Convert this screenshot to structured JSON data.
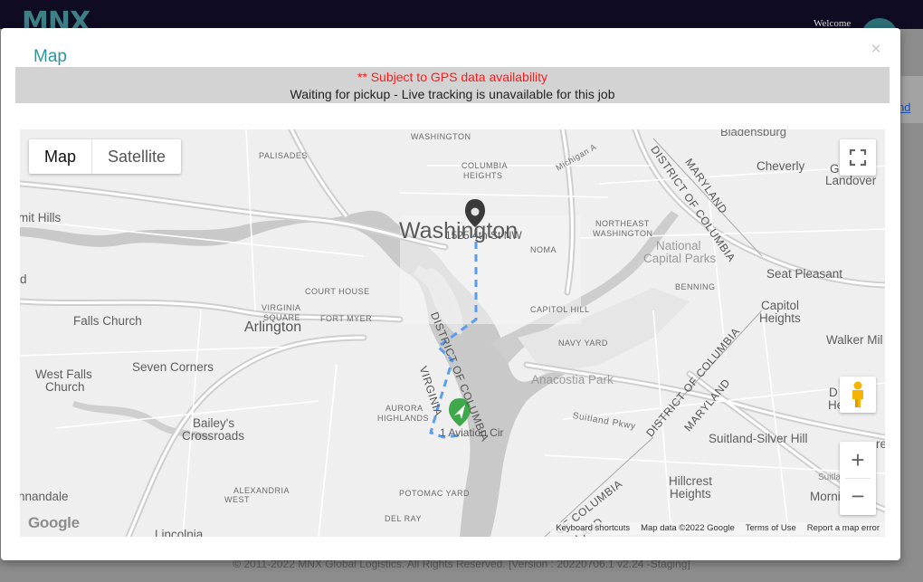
{
  "background": {
    "logo": "MNX",
    "welcome": "Welcome",
    "side_link": "nd",
    "footer": "© 2011-2022 MNX Global Logistics. All Rights Reserved. [Version : 20220706.1 v2.24 -Staging]"
  },
  "modal": {
    "title": "Map",
    "close": "×",
    "warning": "** Subject to GPS data availability",
    "status": "Waiting for pickup - Live tracking is unavailable for this job"
  },
  "map": {
    "type_controls": {
      "map": "Map",
      "satellite": "Satellite"
    },
    "zoom_in": "+",
    "zoom_out": "−",
    "attribution": {
      "shortcuts": "Keyboard shortcuts",
      "data": "Map data ©2022 Google",
      "terms": "Terms of Use",
      "report": "Report a map error"
    },
    "logo": "Google",
    "markers": {
      "destination_address": "1525 4th St NW",
      "origin_address": "1 Aviation Cir"
    },
    "labels": {
      "washington": "Washington",
      "arlington": "Arlington",
      "falls_church": "Falls Church",
      "seven_corners": "Seven Corners",
      "west_falls_church_1": "West Falls",
      "west_falls_church_2": "Church",
      "baileys_1": "Bailey's",
      "baileys_2": "Crossroads",
      "annandale": "nnandale",
      "lincolnia": "Lincolnia",
      "mit_hills": "mit Hills",
      "cheverly": "Cheverly",
      "landover_1": "Gl",
      "landover_2": "Landover",
      "seat_pleasant": "Seat Pleasant",
      "capitol_heights_1": "Capitol",
      "capitol_heights_2": "Heights",
      "walker_mill": "Walker Mil",
      "d_heights_1": "D",
      "d_heights_2": "Heights",
      "suitland": "Suitland-Silver Hill",
      "hillcrest_1": "Hillcrest",
      "hillcrest_2": "Heights",
      "morningside": "Morni",
      "dc_left": "d",
      "national_capital_parks_1": "National",
      "national_capital_parks_2": "Capital Parks",
      "anacostia_park": "Anacostia Park",
      "bladensburg": "Bladensburg",
      "michigan_ave": "Michigan A",
      "suitland_pkwy": "Suitland Pkwy",
      "suitla": "Suitla",
      "re": "re",
      "washington_caps": "WASHINGTON",
      "columbia_heights_1": "COLUMBIA",
      "columbia_heights_2": "HEIGHTS",
      "palisades": "PALISADES",
      "noma": "NOMA",
      "northeast_washington_1": "NORTHEAST",
      "northeast_washington_2": "WASHINGTON",
      "benning": "BENNING",
      "court_house": "COURT HOUSE",
      "virginia_square_1": "VIRGINIA",
      "virginia_square_2": "SQUARE",
      "fort_myer": "FORT MYER",
      "capitol_hill": "CAPITOL HILL",
      "navy_yard": "NAVY YARD",
      "aurora_highlands_1": "AURORA",
      "aurora_highlands_2": "HIGHLANDS",
      "alexandria_west_1": "ALEXANDRIA",
      "alexandria_west_2": "WEST",
      "potomac_yard": "POTOMAC YARD",
      "del_ray": "DEL RAY",
      "border_dc_md_1a": "DISTRICT OF COLUMBIA",
      "border_dc_md_1b": "MARYLAND",
      "border_dc_md_2a": "DISTRICT OF COLUMBIA",
      "border_dc_md_2b": "MARYLAND",
      "border_dc_md_3a": "OF COLUMBIA",
      "border_dc_md_3b": "LAND",
      "border_dc_va_1": "DISTRICT OF COLUMBIA",
      "border_dc_va_2": "VIRGINIA"
    }
  }
}
